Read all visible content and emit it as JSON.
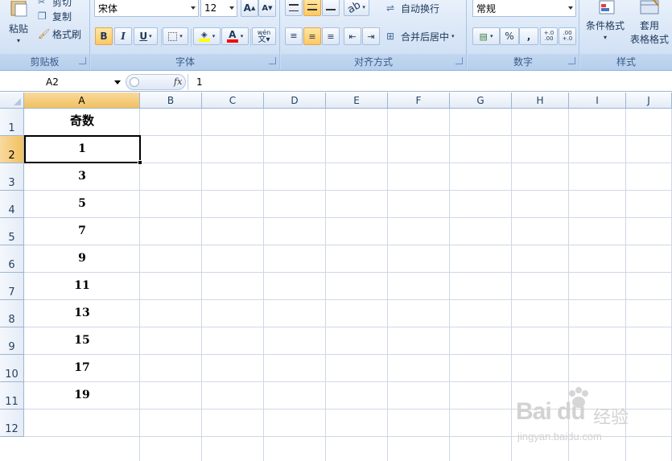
{
  "ribbon": {
    "clipboard": {
      "paste": "粘贴",
      "cut": "剪切",
      "copy": "复制",
      "format_painter": "格式刷",
      "label": "剪贴板"
    },
    "font": {
      "name": "宋体",
      "size": "12",
      "grow": "A",
      "shrink": "A",
      "bold": "B",
      "italic": "I",
      "underline": "U",
      "font_color": "A",
      "phonetic": "wén",
      "label": "字体"
    },
    "alignment": {
      "wrap_text": "自动换行",
      "merge_center": "合并后居中",
      "label": "对齐方式"
    },
    "number": {
      "format": "常规",
      "percent": "%",
      "comma": ",",
      "inc_decimal": "+.0 .00",
      "dec_decimal": ".00 +.0",
      "label": "数字"
    },
    "styles": {
      "conditional": "条件格式",
      "table_line1": "套用",
      "table_line2": "表格格式",
      "label": "样式"
    },
    "colors": {
      "highlight": "#ffff00",
      "font_color": "#ff0000",
      "accent": "#f1c15f"
    }
  },
  "formula_bar": {
    "name_box": "A2",
    "fx": "fx",
    "value": "1"
  },
  "sheet": {
    "columns": [
      "A",
      "B",
      "C",
      "D",
      "E",
      "F",
      "G",
      "H",
      "I",
      "J"
    ],
    "selected_column": "A",
    "rows": [
      "1",
      "2",
      "3",
      "4",
      "5",
      "6",
      "7",
      "8",
      "9",
      "10",
      "11",
      "12"
    ],
    "selected_row": "2",
    "cells": {
      "A1": "奇数",
      "A2": "1",
      "A3": "3",
      "A4": "5",
      "A5": "7",
      "A6": "9",
      "A7": "11",
      "A8": "13",
      "A9": "15",
      "A10": "17",
      "A11": "19"
    },
    "active_cell": "A2"
  },
  "watermark": {
    "logo": "Bai du",
    "text": "经验",
    "url": "jingyan.baidu.com"
  }
}
